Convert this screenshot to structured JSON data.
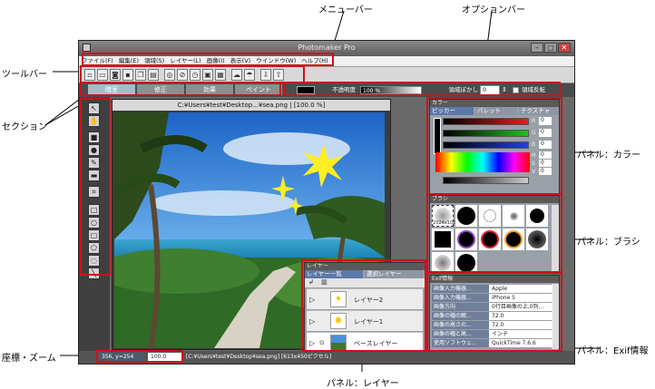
{
  "callouts": {
    "menubar": "メニューバー",
    "optionbar": "オプションバー",
    "toolbar": "ツールバー",
    "section": "セクション",
    "panel_color": "パネル：カラー",
    "panel_brush": "パネル：ブラシ",
    "panel_exif": "パネル：Exif情報",
    "coords_zoom": "座標・ズーム",
    "panel_layer": "パネル：レイヤー"
  },
  "window": {
    "title": "Photomaker Pro",
    "min": "–",
    "max": "□",
    "close": "✕"
  },
  "menu": [
    "ファイル(F)",
    "編集(E)",
    "領域(S)",
    "レイヤー(L)",
    "画像(I)",
    "表示(V)",
    "ウインドウ(W)",
    "ヘルプ(H)"
  ],
  "sections": [
    "暗室",
    "修正",
    "効果",
    "ペイント"
  ],
  "options": {
    "opacity_label": "不透明度",
    "opacity_value": "100 %",
    "blur_label": "領域ぼかし",
    "blur_value": "0",
    "invert_label": "領域反転"
  },
  "document": {
    "title": "C:¥Users¥test¥Desktop...¥sea.png  |    [100.0 %]"
  },
  "color_panel": {
    "title": "カラー",
    "tabs": [
      "ピッカー",
      "パレット",
      "テクスチャ"
    ],
    "channels": [
      {
        "label": "R",
        "value": "0",
        "color": "#e02020"
      },
      {
        "label": "G",
        "value": "0",
        "color": "#20c020"
      },
      {
        "label": "B",
        "value": "0",
        "color": "#2040e0"
      },
      {
        "label": "H",
        "value": "0",
        "color": "#c02060"
      },
      {
        "label": "S",
        "value": "0",
        "color": "#808080"
      },
      {
        "label": "V",
        "value": "0",
        "color": "#a0a0a0"
      }
    ]
  },
  "brush_panel": {
    "title": "ブラシ",
    "size_label": "1024x1024"
  },
  "exif_panel": {
    "title": "Exif情報",
    "rows": [
      {
        "key": "画像入力機器...",
        "value": "Apple"
      },
      {
        "key": "画像入力機器...",
        "value": "iPhone 5"
      },
      {
        "key": "画像方向",
        "value": "0行目画像の上,0列..."
      },
      {
        "key": "画像の幅の解...",
        "value": "72.0"
      },
      {
        "key": "画像の高さの...",
        "value": "72.0"
      },
      {
        "key": "画像の幅と高...",
        "value": "インチ"
      },
      {
        "key": "使用ソフトウェ...",
        "value": "QuickTime 7.6.6"
      }
    ]
  },
  "layer_panel": {
    "title": "レイヤー",
    "tabs": [
      "レイヤー一覧",
      "選択レイヤー"
    ],
    "layers": [
      {
        "name": "レイヤー2"
      },
      {
        "name": "レイヤー1"
      },
      {
        "name": "ベースレイヤー"
      }
    ]
  },
  "status": {
    "coords": "356, y=254",
    "zoom": "100.0",
    "path": "[C:¥Users¥test¥Desktop¥sea.png]  [613x450ピクセル]"
  }
}
